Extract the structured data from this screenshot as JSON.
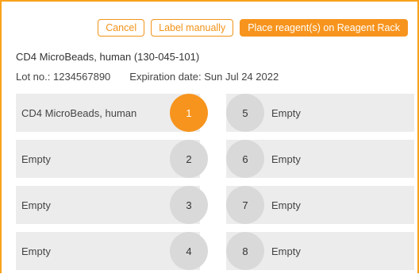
{
  "toolbar": {
    "cancel_label": "Cancel",
    "label_manually_label": "Label manually",
    "place_label": "Place reagent(s) on Reagent Rack"
  },
  "reagent": {
    "product": "CD4 MicroBeads, human (130-045-101)",
    "lot": "Lot no.: 1234567890",
    "expiration": "Expiration date: Sun Jul 24 2022"
  },
  "colors": {
    "accent": "#f7941d",
    "cell_bg": "#ececec",
    "slot_bg": "#d9d9d9"
  },
  "rack": {
    "rows": [
      {
        "left": {
          "label": "CD4 MicroBeads, human",
          "position": "1",
          "selected": true
        },
        "right": {
          "label": "Empty",
          "position": "5",
          "selected": false
        }
      },
      {
        "left": {
          "label": "Empty",
          "position": "2",
          "selected": false
        },
        "right": {
          "label": "Empty",
          "position": "6",
          "selected": false
        }
      },
      {
        "left": {
          "label": "Empty",
          "position": "3",
          "selected": false
        },
        "right": {
          "label": "Empty",
          "position": "7",
          "selected": false
        }
      },
      {
        "left": {
          "label": "Empty",
          "position": "4",
          "selected": false
        },
        "right": {
          "label": "Empty",
          "position": "8",
          "selected": false
        }
      }
    ]
  }
}
